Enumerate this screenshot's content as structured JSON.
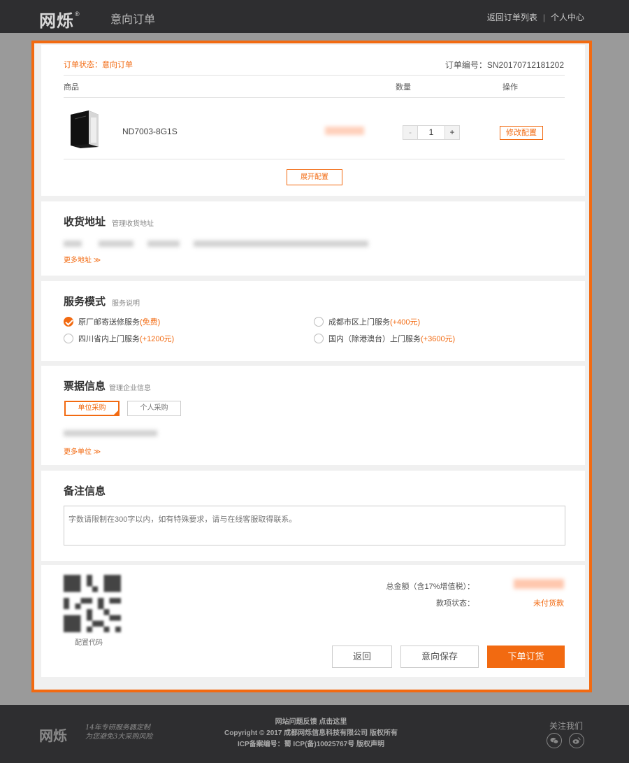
{
  "header": {
    "logo": "网烁",
    "logo_mark": "®",
    "title": "意向订单",
    "link_back": "返回订单列表",
    "separator": "|",
    "link_user": "个人中心"
  },
  "order": {
    "status": "订单状态：意向订单",
    "order_no": "订单编号：SN20170712181202",
    "col_product": "商品",
    "col_qty": "数量",
    "col_action": "操作",
    "product_name": "ND7003-8G1S",
    "qty_minus": "-",
    "qty_value": "1",
    "qty_plus": "+",
    "modify_label": "修改配置",
    "expand_label": "展开配置"
  },
  "address": {
    "title": "收货地址",
    "manage_link": "管理收货地址",
    "more_link": "更多地址 ≫"
  },
  "service": {
    "title": "服务模式",
    "info_link": "服务说明",
    "options": [
      {
        "label": "原厂邮寄送修服务",
        "extra": "(免费)",
        "checked": true
      },
      {
        "label": "成都市区上门服务",
        "extra": "(+400元)",
        "checked": false
      },
      {
        "label": "四川省内上门服务",
        "extra": "(+1200元)",
        "checked": false
      },
      {
        "label": "国内（除港澳台）上门服务",
        "extra": "(+3600元)",
        "checked": false
      }
    ]
  },
  "invoice": {
    "title": "票据信息",
    "manage_link": "管理企业信息",
    "tab_company": "单位采购",
    "tab_personal": "个人采购",
    "more_link": "更多单位 ≫"
  },
  "note": {
    "title": "备注信息",
    "placeholder": "字数请限制在300字以内，如有特殊要求，请与在线客服取得联系。"
  },
  "summary": {
    "qr_label": "配置代码",
    "total_label": "总金额（含17%增值税）：",
    "payment_label": "款项状态：",
    "payment_value": "未付货款",
    "btn_back": "返回",
    "btn_save": "意向保存",
    "btn_order": "下单订货"
  },
  "footer": {
    "logo": "网烁",
    "slogan_line1": "14年专研服务器定制",
    "slogan_line2": "为您避免3大采购风险",
    "feedback": "网站问题反馈 点击这里",
    "copyright": "Copyright © 2017 成都网烁信息科技有限公司 版权所有",
    "icp": "ICP备案编号：蜀 ICP(备)10025767号   版权声明",
    "follow": "关注我们"
  },
  "colors": {
    "accent": "#f26a11",
    "header_bg": "#2e2e30",
    "page_bg": "#9a9a9a"
  }
}
